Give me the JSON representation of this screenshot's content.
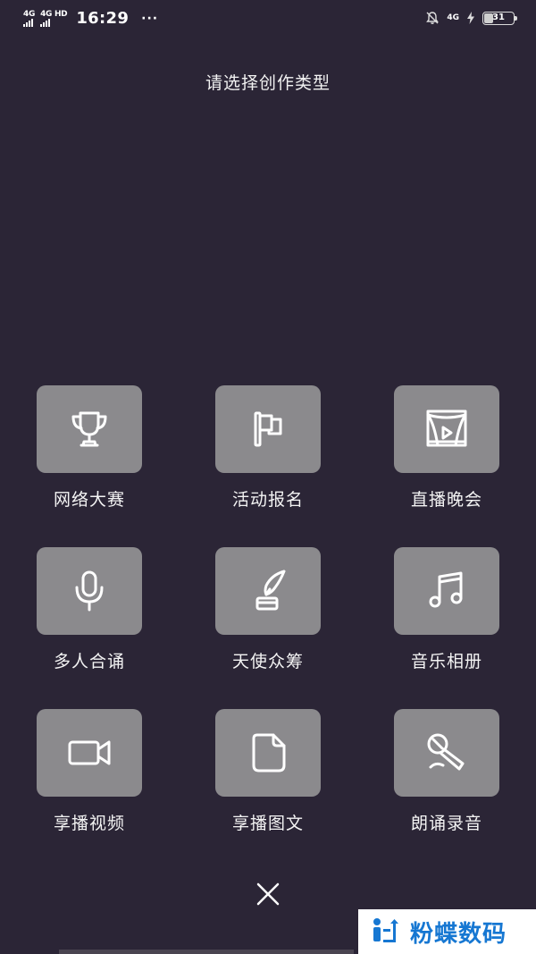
{
  "status_bar": {
    "net1": "4G",
    "net2": "4G HD",
    "time": "16:29",
    "more": "···",
    "net_right": "4G",
    "battery": "31"
  },
  "title": "请选择创作类型",
  "items": [
    {
      "label": "网络大赛",
      "icon": "trophy-icon"
    },
    {
      "label": "活动报名",
      "icon": "flag-icon"
    },
    {
      "label": "直播晚会",
      "icon": "stage-icon"
    },
    {
      "label": "多人合诵",
      "icon": "microphone-icon"
    },
    {
      "label": "天使众筹",
      "icon": "quill-ink-icon"
    },
    {
      "label": "音乐相册",
      "icon": "music-note-icon"
    },
    {
      "label": "享播视频",
      "icon": "video-camera-icon"
    },
    {
      "label": "享播图文",
      "icon": "document-icon"
    },
    {
      "label": "朗诵录音",
      "icon": "handheld-mic-icon"
    }
  ],
  "close_icon": "close-icon",
  "watermark": {
    "text": "粉蝶数码"
  },
  "colors": {
    "background": "#2b2536",
    "tile": "#8b8a8d",
    "watermark_text": "#1677d2"
  }
}
